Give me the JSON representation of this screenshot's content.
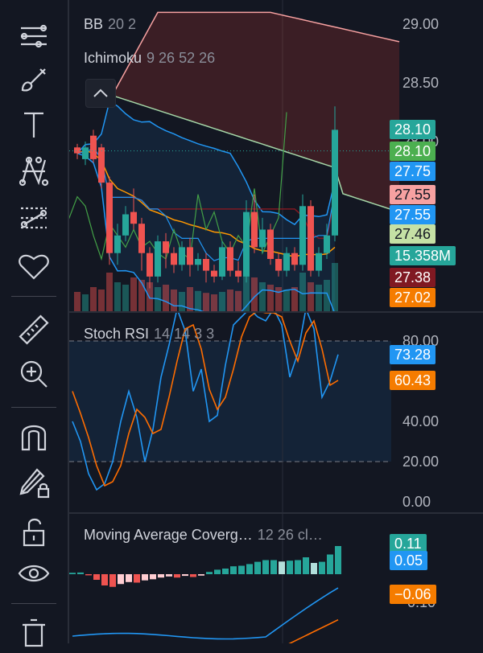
{
  "toolbar": {
    "tools": [
      {
        "name": "trend-line-icon"
      },
      {
        "name": "brush-icon"
      },
      {
        "name": "text-icon"
      },
      {
        "name": "pattern-icon"
      },
      {
        "name": "prediction-icon"
      },
      {
        "name": "favorites-heart-icon"
      },
      {
        "name": "ruler-icon"
      },
      {
        "name": "zoom-in-icon"
      },
      {
        "name": "magnet-icon"
      },
      {
        "name": "lock-drawing-icon"
      },
      {
        "name": "unlock-icon"
      },
      {
        "name": "eye-icon"
      },
      {
        "name": "trash-icon"
      }
    ]
  },
  "main_pane": {
    "legend_bb": {
      "name": "BB",
      "params": "20 2"
    },
    "legend_ichimoku": {
      "name": "Ichimoku",
      "params": "9 26 52 26"
    },
    "scale_labels": [
      {
        "v": 29.0,
        "t": "29.00"
      },
      {
        "v": 28.5,
        "t": "28.50"
      },
      {
        "v": 28.0,
        "t": "28.00"
      }
    ],
    "badges": [
      {
        "t": "28.10",
        "v": 28.1,
        "bg": "#26a69a",
        "fg": "#ffffff"
      },
      {
        "t": "28.10",
        "v": 27.92,
        "bg": "#4caf50",
        "fg": "#ffffff"
      },
      {
        "t": "27.75",
        "v": 27.75,
        "bg": "#2196f3",
        "fg": "#ffffff"
      },
      {
        "t": "27.55",
        "v": 27.55,
        "bg": "#f7a1a1",
        "fg": "#131722"
      },
      {
        "t": "27.55",
        "v": 27.38,
        "bg": "#2196f3",
        "fg": "#ffffff"
      },
      {
        "t": "27.46",
        "v": 27.21,
        "bg": "#c5e1a5",
        "fg": "#131722"
      },
      {
        "t": "15.358M",
        "v": 27.03,
        "bg": "#26a69a",
        "fg": "#ffffff"
      },
      {
        "t": "27.38",
        "v": 26.84,
        "bg": "#801922",
        "fg": "#ffffff"
      },
      {
        "t": "27.02",
        "v": 26.67,
        "bg": "#f57c00",
        "fg": "#ffffff"
      }
    ],
    "colors": {
      "up": "#26a69a",
      "down": "#ef5350",
      "bb": "#2196f3",
      "basis": "#ff9800",
      "cloud_down": "#f7a1a1",
      "cloud_up": "#a5d6a7",
      "conv": "#2196f3",
      "base": "#801922",
      "lag": "#43a047"
    }
  },
  "stoch_pane": {
    "legend": {
      "name": "Stoch RSI",
      "params": "14 14 3 3"
    },
    "scale_labels": [
      {
        "v": 80,
        "t": "80.00"
      },
      {
        "v": 40,
        "t": "40.00"
      },
      {
        "v": 20,
        "t": "20.00"
      },
      {
        "v": 0,
        "t": "0.00"
      }
    ],
    "badges": [
      {
        "t": "73.28",
        "v": 73.28,
        "bg": "#2196f3",
        "fg": "#ffffff"
      },
      {
        "t": "60.43",
        "v": 60.43,
        "bg": "#f57c00",
        "fg": "#ffffff"
      }
    ],
    "k_values": [
      40,
      30,
      14,
      6,
      9,
      20,
      40,
      55,
      42,
      20,
      36,
      62,
      78,
      96,
      85,
      55,
      66,
      40,
      43,
      68,
      88,
      92,
      96,
      92,
      90,
      96,
      88,
      62,
      74,
      96,
      86,
      52,
      60,
      73.28
    ],
    "d_values": [
      55,
      44,
      32,
      18,
      8,
      10,
      18,
      34,
      46,
      42,
      34,
      36,
      52,
      70,
      86,
      88,
      76,
      56,
      46,
      52,
      66,
      82,
      92,
      95,
      94,
      94,
      92,
      80,
      70,
      84,
      90,
      76,
      58,
      60.43
    ]
  },
  "macd_pane": {
    "legend": {
      "name": "Moving Average Coverg…",
      "params": "12 26 cl…"
    },
    "scale_labels": [
      {
        "v": -0.1,
        "t": "-0.10"
      }
    ],
    "badges": [
      {
        "t": "0.11",
        "v": 0.11,
        "bg": "#26a69a",
        "fg": "#ffffff"
      },
      {
        "t": "0.05",
        "v": 0.05,
        "bg": "#2196f3",
        "fg": "#ffffff"
      },
      {
        "t": "−0.06",
        "v": -0.07,
        "bg": "#f57c00",
        "fg": "#ffffff"
      }
    ],
    "hist": [
      0.005,
      0.006,
      -0.004,
      -0.02,
      -0.04,
      -0.045,
      -0.035,
      -0.028,
      -0.03,
      -0.022,
      -0.018,
      -0.012,
      -0.008,
      -0.012,
      -0.006,
      -0.01,
      -0.005,
      0.008,
      0.016,
      0.02,
      0.028,
      0.03,
      0.036,
      0.044,
      0.05,
      0.05,
      0.045,
      0.048,
      0.05,
      0.06,
      0.04,
      0.044,
      0.07,
      0.1
    ]
  },
  "chart_data": {
    "type": "candlestick",
    "candles": [
      [
        27.95,
        27.9,
        27.98,
        27.85
      ],
      [
        27.85,
        27.95,
        28.0,
        27.8
      ],
      [
        28.05,
        27.85,
        28.1,
        27.82
      ],
      [
        27.95,
        27.65,
        27.98,
        27.6
      ],
      [
        27.65,
        27.05,
        27.7,
        26.95
      ],
      [
        27.05,
        27.2,
        27.3,
        26.95
      ],
      [
        27.2,
        27.38,
        27.45,
        27.15
      ],
      [
        27.4,
        27.3,
        27.6,
        27.25
      ],
      [
        27.3,
        27.05,
        27.35,
        26.9
      ],
      [
        27.05,
        26.85,
        27.1,
        26.75
      ],
      [
        26.85,
        27.15,
        27.2,
        26.8
      ],
      [
        27.15,
        27.05,
        27.22,
        26.92
      ],
      [
        27.05,
        26.95,
        27.1,
        26.88
      ],
      [
        26.95,
        27.1,
        27.15,
        26.9
      ],
      [
        27.1,
        26.95,
        27.18,
        26.85
      ],
      [
        26.95,
        27.0,
        27.05,
        26.9
      ],
      [
        27.0,
        26.9,
        27.05,
        26.8
      ],
      [
        26.9,
        26.85,
        26.95,
        26.8
      ],
      [
        26.85,
        27.1,
        27.15,
        26.82
      ],
      [
        27.1,
        26.9,
        27.15,
        26.85
      ],
      [
        26.9,
        26.85,
        26.98,
        26.8
      ],
      [
        26.85,
        27.4,
        27.5,
        26.8
      ],
      [
        27.4,
        27.1,
        27.55,
        27.05
      ],
      [
        27.1,
        27.25,
        27.35,
        27.05
      ],
      [
        27.25,
        27.0,
        27.3,
        26.95
      ],
      [
        27.0,
        26.9,
        27.05,
        26.85
      ],
      [
        26.9,
        27.05,
        27.1,
        26.85
      ],
      [
        27.05,
        26.95,
        27.1,
        26.9
      ],
      [
        26.95,
        27.45,
        27.55,
        26.9
      ],
      [
        27.45,
        26.9,
        27.5,
        26.85
      ],
      [
        26.9,
        27.05,
        27.1,
        26.85
      ],
      [
        27.05,
        27.2,
        27.3,
        27.0
      ],
      [
        27.2,
        28.1,
        28.3,
        27.15
      ]
    ]
  }
}
